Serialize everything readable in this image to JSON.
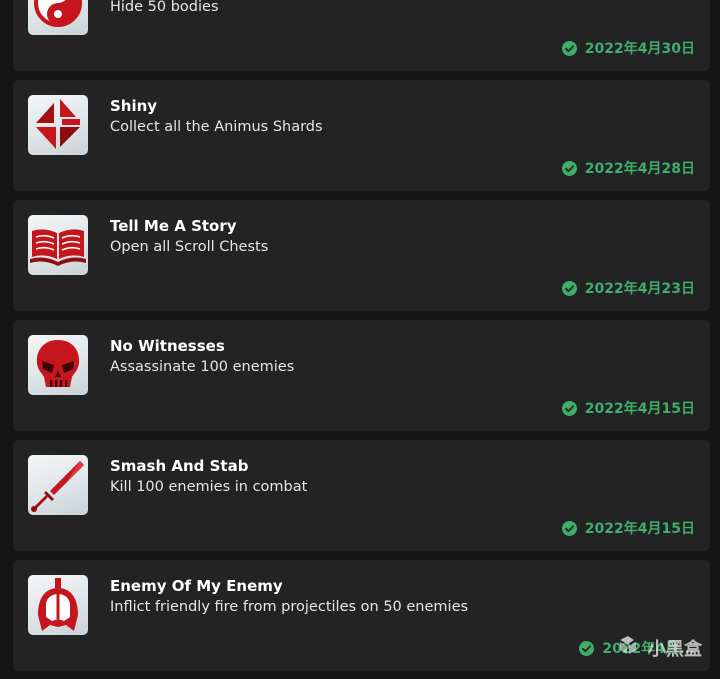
{
  "achievements": [
    {
      "title": "",
      "description": "Hide 50 bodies",
      "date": "2022年4月30日",
      "icon": "yin-yang-emblem-icon"
    },
    {
      "title": "Shiny",
      "description": "Collect all the Animus Shards",
      "date": "2022年4月28日",
      "icon": "animus-shard-icon"
    },
    {
      "title": "Tell Me A Story",
      "description": "Open all Scroll Chests",
      "date": "2022年4月23日",
      "icon": "open-book-icon"
    },
    {
      "title": "No Witnesses",
      "description": "Assassinate 100 enemies",
      "date": "2022年4月15日",
      "icon": "skull-icon"
    },
    {
      "title": "Smash And Stab",
      "description": "Kill 100 enemies in combat",
      "date": "2022年4月15日",
      "icon": "dagger-icon"
    },
    {
      "title": "Enemy Of My Enemy",
      "description": "Inflict friendly fire from projectiles on 50 enemies",
      "date": "2022年4月...",
      "icon": "helmet-icon"
    }
  ],
  "watermark": {
    "text": "小黑盒"
  },
  "colors": {
    "background": "#161616",
    "card": "#232323",
    "accent_green": "#3fae6a",
    "icon_red": "#c4161c"
  }
}
